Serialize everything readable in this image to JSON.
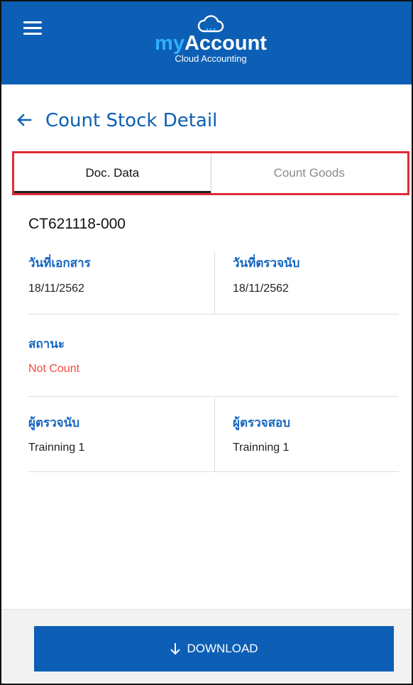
{
  "header": {
    "logo_my": "my",
    "logo_account": "Account",
    "logo_subtitle": "Cloud Accounting",
    "brand_color": "#0c5fb4"
  },
  "titlebar": {
    "back_icon": "arrow-left-icon",
    "title": "Count Stock Detail"
  },
  "tabs": [
    {
      "label": "Doc. Data",
      "active": true
    },
    {
      "label": "Count Goods",
      "active": false
    }
  ],
  "document": {
    "number": "CT621118-000",
    "doc_date_label": "วันที่เอกสาร",
    "doc_date_value": "18/11/2562",
    "count_date_label": "วันที่ตรวจนับ",
    "count_date_value": "18/11/2562",
    "status_label": "สถานะ",
    "status_value": "Not Count",
    "status_color": "#f04a3c",
    "counter_label": "ผู้ตรวจนับ",
    "counter_value": "Trainning 1",
    "inspector_label": "ผู้ตรวจสอบ",
    "inspector_value": "Trainning 1"
  },
  "footer": {
    "download_label": "DOWNLOAD",
    "download_icon": "arrow-down-icon"
  }
}
